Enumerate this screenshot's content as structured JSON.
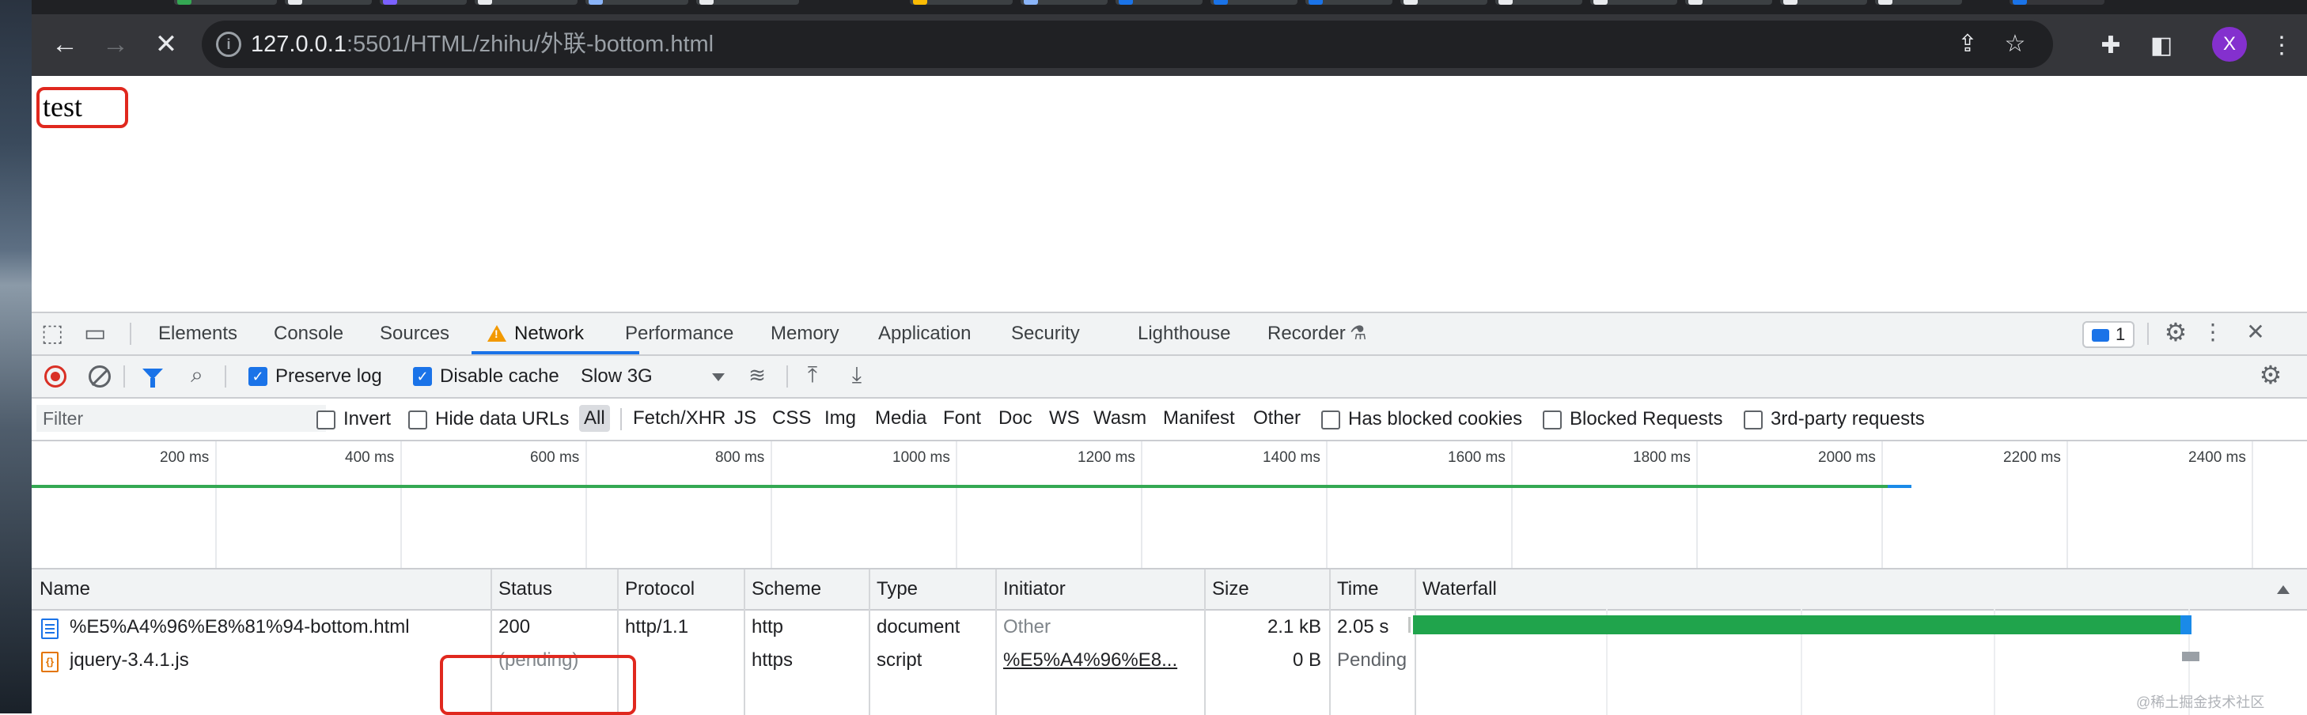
{
  "browser": {
    "url_host": "127.0.0.1",
    "url_rest": ":5501/HTML/zhihu/外联-bottom.html",
    "avatar_letter": "X",
    "accent_color": "#8430ce"
  },
  "page": {
    "text": "test"
  },
  "devtools": {
    "tabs": [
      "Elements",
      "Console",
      "Sources",
      "Network",
      "Performance",
      "Memory",
      "Application",
      "Security",
      "Lighthouse",
      "Recorder"
    ],
    "active_tab": "Network",
    "issues_count": "1",
    "toolbar": {
      "preserve_log_label": "Preserve log",
      "preserve_log_checked": true,
      "disable_cache_label": "Disable cache",
      "disable_cache_checked": true,
      "throttling": "Slow 3G"
    },
    "filter": {
      "placeholder": "Filter",
      "invert_label": "Invert",
      "hide_data_urls_label": "Hide data URLs",
      "types": [
        "All",
        "Fetch/XHR",
        "JS",
        "CSS",
        "Img",
        "Media",
        "Font",
        "Doc",
        "WS",
        "Wasm",
        "Manifest",
        "Other"
      ],
      "active_type": "All",
      "has_blocked_cookies_label": "Has blocked cookies",
      "blocked_requests_label": "Blocked Requests",
      "third_party_label": "3rd-party requests"
    },
    "overview_ticks": [
      "200 ms",
      "400 ms",
      "600 ms",
      "800 ms",
      "1000 ms",
      "1200 ms",
      "1400 ms",
      "1600 ms",
      "1800 ms",
      "2000 ms",
      "2200 ms",
      "2400 ms"
    ],
    "table": {
      "columns": [
        "Name",
        "Status",
        "Protocol",
        "Scheme",
        "Type",
        "Initiator",
        "Size",
        "Time",
        "Waterfall"
      ],
      "rows": [
        {
          "name": "%E5%A4%96%E8%81%94-bottom.html",
          "status": "200",
          "protocol": "http/1.1",
          "scheme": "http",
          "type": "document",
          "initiator": "Other",
          "size": "2.1 kB",
          "time": "2.05 s"
        },
        {
          "name": "jquery-3.4.1.js",
          "status": "(pending)",
          "protocol": "",
          "scheme": "https",
          "type": "script",
          "initiator": "%E5%A4%96%E8...",
          "size": "0 B",
          "time": "Pending"
        }
      ]
    }
  },
  "watermark": "@稀土掘金技术社区"
}
